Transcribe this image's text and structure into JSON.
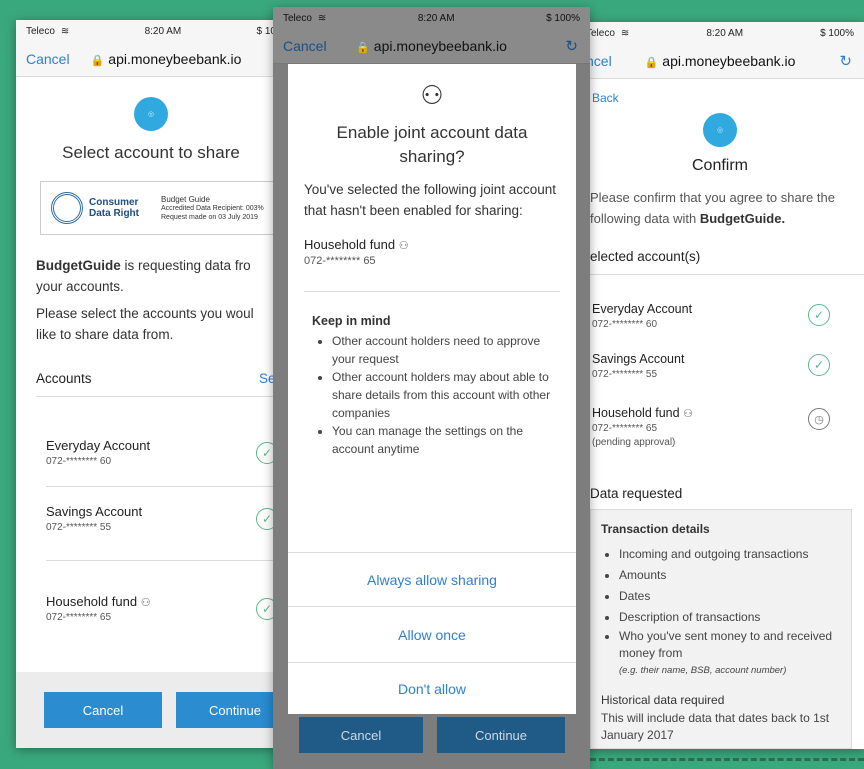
{
  "status": {
    "carrier": "Teleco",
    "time": "8:20 AM",
    "battery_partial": "$ 10",
    "battery_full": "$ 100%"
  },
  "browser": {
    "cancel_label": "Cancel",
    "cancel_partial": "ncel",
    "url": "api.moneybeebank.io"
  },
  "left": {
    "title": "Select account to share",
    "cdr_line1": "Consumer",
    "cdr_line2": "Data Right",
    "recipient_name": "Budget Guide",
    "recipient_line1": "Accredited Data Recipient: 003%",
    "recipient_line2": "Request made on 03 July 2019",
    "requester": "BudgetGuide",
    "request_text": " is requesting data fro your accounts.",
    "instruction": "Please select the accounts you woul like to share data from.",
    "accounts_header": "Accounts",
    "select_all": "Sele",
    "accounts": [
      {
        "name": "Everyday Account",
        "number": "072-******** 60"
      },
      {
        "name": "Savings Account",
        "number": "072-******** 55"
      },
      {
        "name": "Household fund",
        "number": "072-******** 65"
      }
    ],
    "cancel_button": "Cancel",
    "continue_button": "Continue"
  },
  "middle": {
    "title": "Enable joint account data sharing?",
    "message": "You've selected the following joint account that hasn't been enabled for sharing:",
    "account_name": "Household fund",
    "account_number": "072-******** 65",
    "keep_in_mind": "Keep in mind",
    "bullets": [
      "Other account holders need to approve your request",
      "Other account holders may about able to share details from this account with other companies",
      "You can manage the settings on the account anytime"
    ],
    "always_allow": "Always allow sharing",
    "allow_once": "Allow once",
    "dont_allow": "Don't allow",
    "cancel_button": "Cancel",
    "continue_button": "Continue"
  },
  "right": {
    "back": "Back",
    "title": "Confirm",
    "confirm_text": "Please confirm that you agree to share the following data with ",
    "confirm_brand": "BudgetGuide.",
    "selected_header": "elected account(s)",
    "accounts": [
      {
        "name": "Everyday Account",
        "number": "072-******** 60",
        "note": ""
      },
      {
        "name": "Savings Account",
        "number": "072-******** 55",
        "note": ""
      },
      {
        "name": "Household fund",
        "number": "072-******** 65",
        "note": "(pending approval)"
      }
    ],
    "data_requested": "Data requested",
    "transaction_title": "Transaction details",
    "transaction_items": [
      "Incoming and outgoing transactions",
      "Amounts",
      "Dates",
      "Description of transactions",
      "Who you've sent money to and received money from"
    ],
    "transaction_example": "(e.g. their name, BSB, account number)",
    "historical_title": "Historical data required",
    "historical_text": "This will include data that dates back to 1st January 2017"
  },
  "colors": {
    "background": "#3aa87d",
    "link": "#2f7fd1",
    "button": "#2b8cd0",
    "check": "#5ab88e"
  }
}
